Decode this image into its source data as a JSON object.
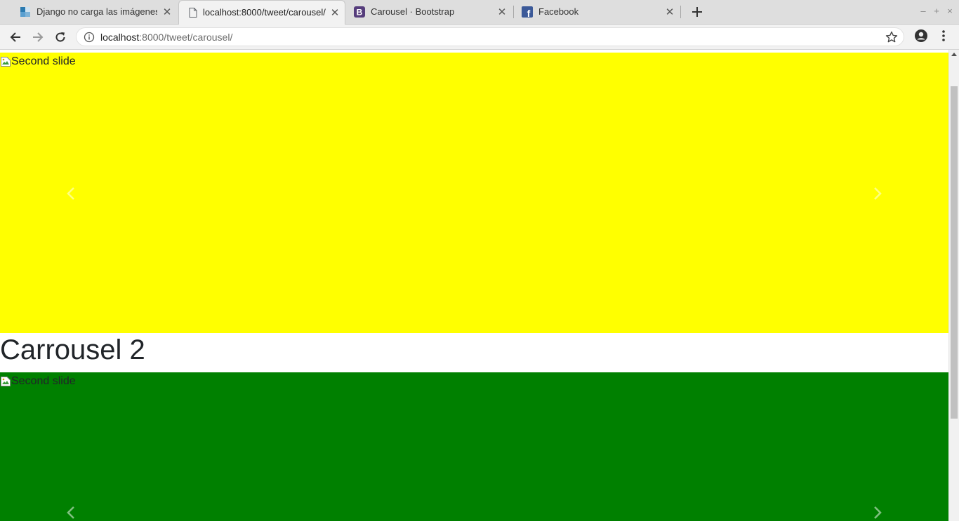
{
  "browser": {
    "tabs": [
      {
        "title": "Django no carga las imágenes",
        "favicon": "stackoverflow-icon",
        "active": false
      },
      {
        "title": "localhost:8000/tweet/carousel/",
        "favicon": "page-icon",
        "active": true
      },
      {
        "title": "Carousel · Bootstrap",
        "favicon": "bootstrap-icon",
        "active": false
      },
      {
        "title": "Facebook",
        "favicon": "facebook-icon",
        "active": false
      }
    ],
    "new_tab_label": "+",
    "window_controls": {
      "minimize": "–",
      "maximize": "+",
      "close": "×"
    },
    "address": {
      "host": "localhost",
      "path": ":8000/tweet/carousel/"
    }
  },
  "page": {
    "carousel1": {
      "image_alt": "Second slide",
      "background": "#ffff00"
    },
    "heading": "Carrousel 2",
    "carousel2": {
      "image_alt": "Second slide",
      "background": "#008000"
    }
  },
  "colors": {
    "accent_bootstrap": "#563d7c",
    "facebook_blue": "#3b5998"
  }
}
